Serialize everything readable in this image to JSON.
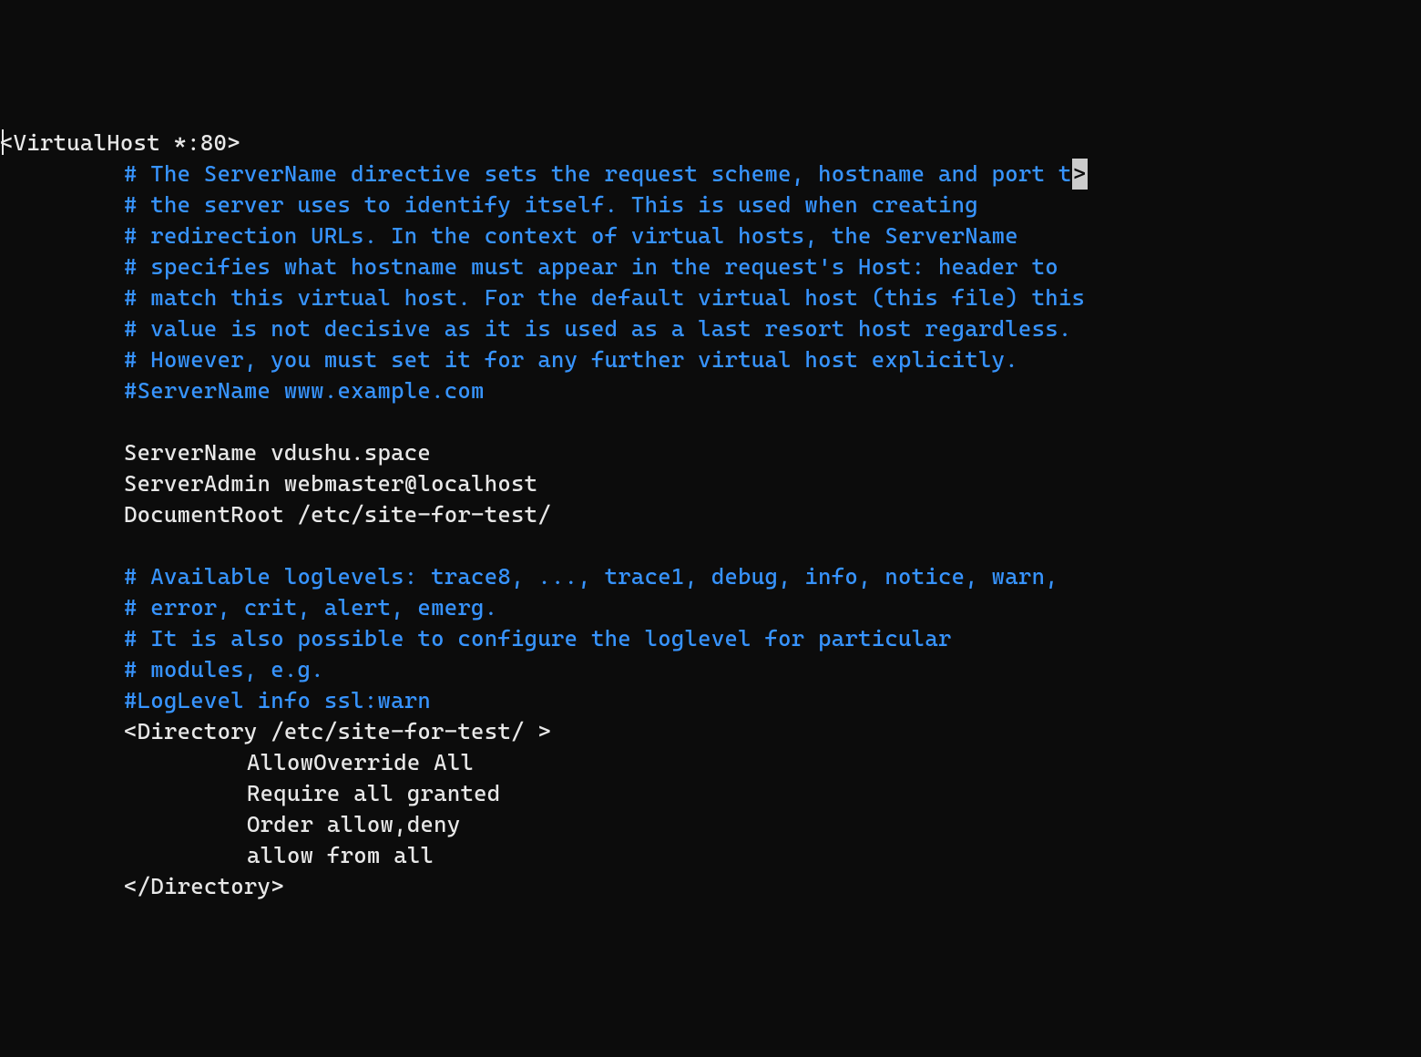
{
  "lines": {
    "l0": "<VirtualHost *:80>",
    "l0_cursor": ">",
    "l1": "# The ServerName directive sets the request scheme, hostname and port t",
    "l2": "# the server uses to identify itself. This is used when creating",
    "l3": "# redirection URLs. In the context of virtual hosts, the ServerName",
    "l4": "# specifies what hostname must appear in the request's Host: header to",
    "l5": "# match this virtual host. For the default virtual host (this file) this",
    "l6": "# value is not decisive as it is used as a last resort host regardless.",
    "l7": "# However, you must set it for any further virtual host explicitly.",
    "l8": "#ServerName www.example.com",
    "l9": "",
    "l10": "ServerName vdushu.space",
    "l11": "ServerAdmin webmaster@localhost",
    "l12": "DocumentRoot /etc/site-for-test/",
    "l13": "",
    "l14": "# Available loglevels: trace8, ..., trace1, debug, info, notice, warn,",
    "l15": "# error, crit, alert, emerg.",
    "l16": "# It is also possible to configure the loglevel for particular",
    "l17": "# modules, e.g.",
    "l18": "#LogLevel info ssl:warn",
    "l19": "<Directory /etc/site-for-test/ >",
    "l20": "AllowOverride All",
    "l21": "Require all granted",
    "l22": "Order allow,deny",
    "l23": "allow from all",
    "l24": "</Directory>"
  }
}
